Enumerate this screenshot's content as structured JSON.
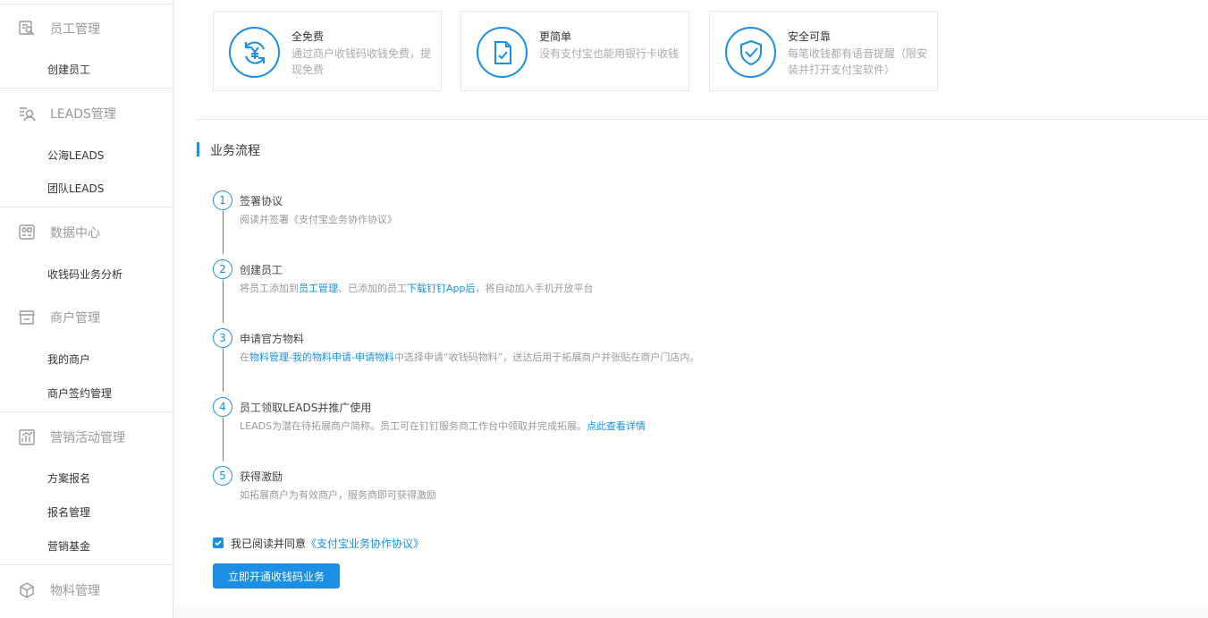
{
  "colors": {
    "accent": "#1a8fe3",
    "muted_text": "#999999",
    "border": "#e6e6e6"
  },
  "sidebar": {
    "sections": [
      {
        "title": "员工管理",
        "icon": "employee-icon",
        "items": [
          "创建员工"
        ]
      },
      {
        "title": "LEADS管理",
        "icon": "leads-search-icon",
        "items": [
          "公海LEADS",
          "团队LEADS"
        ]
      },
      {
        "title": "数据中心",
        "icon": "data-center-icon",
        "items": [
          "收钱码业务分析"
        ]
      },
      {
        "title": "商户管理",
        "icon": "store-icon",
        "items": [
          "我的商户",
          "商户签约管理"
        ]
      },
      {
        "title": "营销活动管理",
        "icon": "chart-icon",
        "items": [
          "方案报名",
          "报名管理",
          "营销基金"
        ]
      },
      {
        "title": "物料管理",
        "icon": "box-icon",
        "items": []
      }
    ]
  },
  "features": [
    {
      "title": "全免费",
      "desc": "通过商户收钱码收钱免费，提现免费",
      "icon": "yen-refresh-icon"
    },
    {
      "title": "更简单",
      "desc": "没有支付宝也能用银行卡收钱",
      "icon": "document-check-icon"
    },
    {
      "title": "安全可靠",
      "desc": "每笔收钱都有语音提醒（限安装并打开支付宝软件）",
      "icon": "shield-check-icon"
    }
  ],
  "process": {
    "title": "业务流程",
    "steps": [
      {
        "num": "1",
        "title": "签署协议",
        "desc": "阅读并签署《支付宝业务协作协议》"
      },
      {
        "num": "2",
        "title": "创建员工",
        "desc_a": "将员工添加到",
        "link_a": "员工管理",
        "desc_b": "、已添加的员工",
        "link_b": "下载钉钉App后",
        "desc_c": "，将自动加入手机开放平台"
      },
      {
        "num": "3",
        "title": "申请官方物料",
        "desc_a": "在",
        "link_a": "物料管理-我的物料申请-申请物料",
        "desc_b": "中选择申请“收钱码物料”，送达后用于拓展商户并张贴在商户门店内。"
      },
      {
        "num": "4",
        "title": "员工领取LEADS并推广使用",
        "desc_a": "LEADS为潜在待拓展商户简称。员工可在钉钉服务商工作台中领取并完成拓展。",
        "link_a": "点此查看详情"
      },
      {
        "num": "5",
        "title": "获得激励",
        "desc": "如拓展商户为有效商户，服务商即可获得激励"
      }
    ]
  },
  "agreement": {
    "checked": true,
    "text": "我已阅读并同意",
    "link": "《支付宝业务协作协议》"
  },
  "submit_button": "立即开通收钱码业务"
}
